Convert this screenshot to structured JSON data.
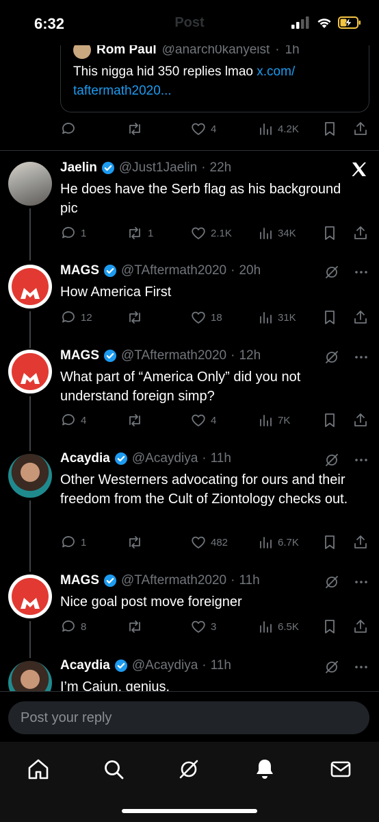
{
  "status_bar": {
    "time": "6:32"
  },
  "nav": {
    "title": "Post"
  },
  "quote": {
    "name": "Rom Paul",
    "handle": "@anarch0kanyeist",
    "time": "1h",
    "text": "This nigga hid 350 replies lmao",
    "link": "x.com/\ntaftermath2020..."
  },
  "root_actions": {
    "replies": "",
    "reposts": "",
    "likes": "4",
    "views": "4.2K"
  },
  "posts": [
    {
      "name": "Jaelin",
      "handle": "@Just1Jaelin",
      "time": "22h",
      "text": "He does have the Serb flag as his background pic",
      "replies": "1",
      "reposts": "1",
      "likes": "2.1K",
      "views": "34K"
    },
    {
      "name": "MAGS",
      "handle": "@TAftermath2020",
      "time": "20h",
      "text": "How America First",
      "replies": "12",
      "reposts": "",
      "likes": "18",
      "views": "31K"
    },
    {
      "name": "MAGS",
      "handle": "@TAftermath2020",
      "time": "12h",
      "text": "What part of “America Only” did you not understand foreign simp?",
      "replies": "4",
      "reposts": "",
      "likes": "4",
      "views": "7K"
    },
    {
      "name": "Acaydia",
      "handle": "@Acaydiya",
      "time": "11h",
      "text": "Other Westerners advocating for ours and their freedom from the Cult of Ziontology checks out.",
      "replies": "1",
      "reposts": "",
      "likes": "482",
      "views": "6.7K"
    },
    {
      "name": "MAGS",
      "handle": "@TAftermath2020",
      "time": "11h",
      "text": "Nice goal post move foreigner",
      "replies": "8",
      "reposts": "",
      "likes": "3",
      "views": "6.5K"
    },
    {
      "name": "Acaydia",
      "handle": "@Acaydiya",
      "time": "11h",
      "text": "I’m Cajun, genius."
    }
  ],
  "reply": {
    "placeholder": "Post your reply"
  },
  "colors": {
    "background": "#000000",
    "text": "#e7e9ea",
    "muted": "#71767b",
    "link": "#1d9bf0",
    "verified": "#1d9bf0",
    "mags_red": "#e23a32"
  }
}
